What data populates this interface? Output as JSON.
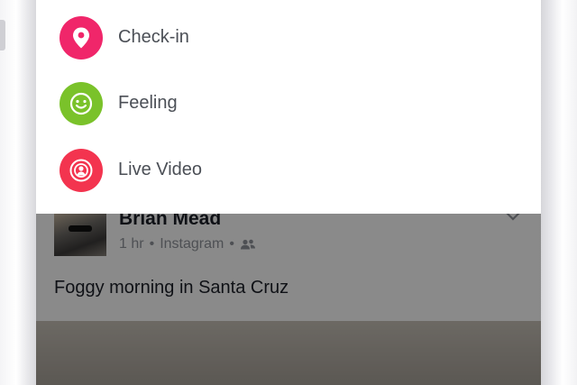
{
  "menu": {
    "items": [
      {
        "label": "Check-in",
        "icon": "location-pin-icon",
        "color": "#f0266a"
      },
      {
        "label": "Feeling",
        "icon": "smiley-icon",
        "color": "#7ac22a"
      },
      {
        "label": "Live Video",
        "icon": "live-broadcast-icon",
        "color": "#f3344f"
      }
    ]
  },
  "post": {
    "author": "Brian Mead",
    "time": "1 hr",
    "source": "Instagram",
    "separator": "•",
    "audience_icon": "friends-icon",
    "text": "Foggy morning in Santa Cruz"
  },
  "colors": {
    "dim_overlay": "rgba(0,0,0,0.46)",
    "sheet_bg": "#ffffff"
  }
}
